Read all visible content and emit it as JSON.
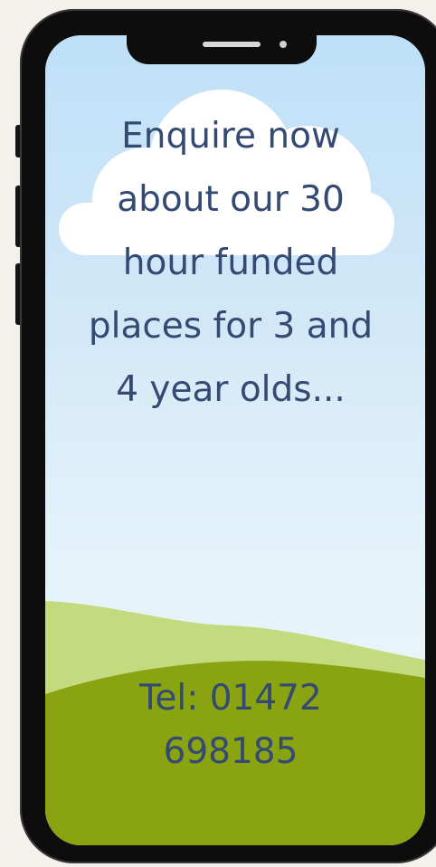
{
  "promo": {
    "headline": "Enquire now about our 30 hour funded places for 3 and 4 year olds..."
  },
  "contact": {
    "phone": "Tel: 01472 698185"
  },
  "colors": {
    "background": "#f4f0eb",
    "phone_body": "#0d0d0d",
    "text": "#344a72",
    "sky": "#c6e2f8",
    "cloud": "#ffffff",
    "hill_light": "#c3db7e",
    "hill_dark": "#8aa310"
  },
  "icons": {
    "cloud": "cloud-icon",
    "camera": "camera-dot-icon",
    "speaker": "speaker-slot-icon"
  }
}
